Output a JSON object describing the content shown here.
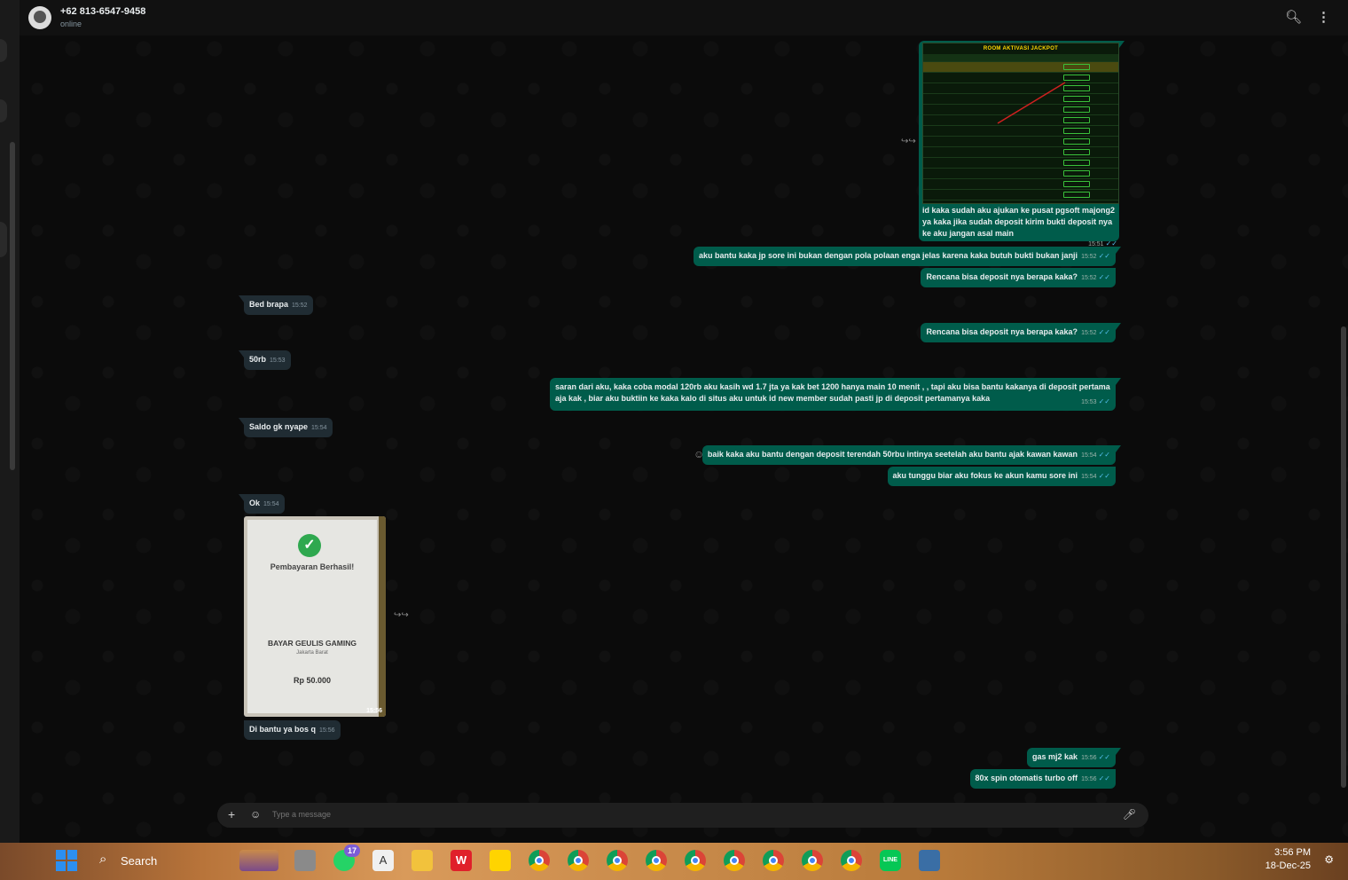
{
  "header": {
    "contact_name": "+62 813-6547-9458",
    "contact_status": "online",
    "search_icon": "search-icon",
    "menu_icon": "kebab-menu-icon"
  },
  "jackpot_image": {
    "title": "ROOM AKTIVASI JACKPOT"
  },
  "messages": [
    {
      "dir": "out",
      "text": "id kaka sudah aku ajukan ke pusat pgsoft majong2 ya kaka jika sudah deposit kirim bukti deposit nya ke aku jangan asal main",
      "time": "15:51"
    },
    {
      "dir": "out",
      "text": "aku bantu kaka jp sore ini bukan dengan pola polaan enga jelas karena kaka butuh bukti bukan janji",
      "time": "15:52"
    },
    {
      "dir": "out",
      "text": "Rencana bisa deposit nya berapa kaka?",
      "time": "15:52"
    },
    {
      "dir": "in",
      "text": "Bed brapa",
      "time": "15:52"
    },
    {
      "dir": "out",
      "text": "Rencana bisa deposit nya berapa kaka?",
      "time": "15:52"
    },
    {
      "dir": "in",
      "text": "50rb",
      "time": "15:53"
    },
    {
      "dir": "out",
      "text": "saran dari aku, kaka coba modal 120rb aku kasih wd 1.7 jta ya kak bet 1200 hanya main 10 menit , , tapi aku bisa bantu kakanya di deposit pertama aja kak , biar aku buktiin ke kaka kalo di situs aku untuk id new member sudah pasti jp di deposit pertamanya kaka",
      "time": "15:53"
    },
    {
      "dir": "in",
      "text": "Saldo gk nyape",
      "time": "15:54"
    },
    {
      "dir": "out",
      "text": "baik kaka aku bantu dengan deposit terendah 50rbu intinya seetelah aku bantu ajak kawan kawan",
      "time": "15:54"
    },
    {
      "dir": "out",
      "text": "aku tunggu biar aku fokus ke akun kamu sore ini",
      "time": "15:54"
    },
    {
      "dir": "in",
      "text": "Ok",
      "time": "15:54"
    },
    {
      "dir": "in",
      "text": "Di bantu ya bos q",
      "time": "15:56"
    },
    {
      "dir": "out",
      "text": "gas mj2 kak",
      "time": "15:56"
    },
    {
      "dir": "out",
      "text": "80x spin otomatis turbo off",
      "time": "15:56"
    }
  ],
  "payment_image": {
    "title": "Pembayaran Berhasil!",
    "merchant": "BAYAR GEULIS GAMING",
    "city": "Jakarta Barat",
    "amount": "Rp 50.000",
    "time": "15:56"
  },
  "composer": {
    "placeholder": "Type a message"
  },
  "taskbar": {
    "search_label": "Search",
    "whatsapp_badge": "17",
    "time": "3:56 PM",
    "date": "18-Dec-25"
  },
  "colors": {
    "outgoing_bubble": "#005c4b",
    "incoming_bubble": "#202c33",
    "read_ticks": "#53bdeb"
  }
}
